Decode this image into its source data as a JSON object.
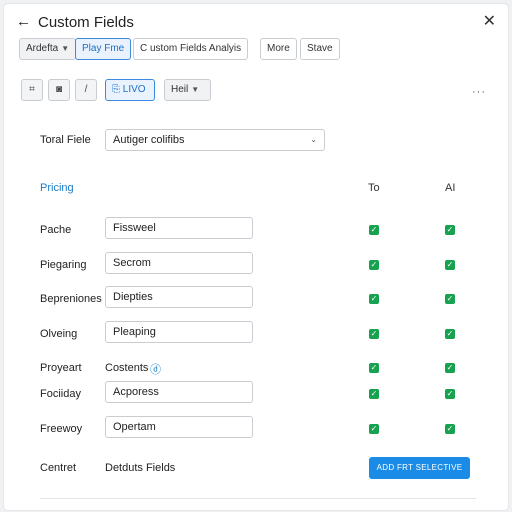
{
  "header": {
    "back_icon": "arrow-left-icon",
    "title": "Custom Fields",
    "close_icon": "close-icon"
  },
  "toolbar1": {
    "dropdown_label": "Ardefta",
    "play_label": "Play Fme",
    "analysis_label": "C ustom Fields Analyis",
    "more_label": "More",
    "save_label": "Stave"
  },
  "toolbar2": {
    "icons": [
      "hash-icon",
      "shield-icon",
      "slash-icon"
    ],
    "icon_glyphs": [
      "⌗",
      "◙",
      "/"
    ],
    "live_label": "LIVO",
    "hell_label": "Heil",
    "more_glyph": "···"
  },
  "total_field": {
    "label": "Toral Fiele",
    "value": "Autiger colifibs"
  },
  "section": {
    "title": "Pricing",
    "col_to": "To",
    "col_ai": "AI"
  },
  "rows": [
    {
      "label": "Pache",
      "value": "Fissweel",
      "has_input": true,
      "to": true,
      "ai": true
    },
    {
      "label": "Piegaring",
      "value": "Secrom",
      "has_input": true,
      "to": true,
      "ai": true
    },
    {
      "label": "Bepreniones",
      "value": "Diepties",
      "has_input": true,
      "to": true,
      "ai": true
    },
    {
      "label": "Olveing",
      "value": "Pleaping",
      "has_input": true,
      "to": true,
      "ai": true
    },
    {
      "label": "Proyeart",
      "value": "Costents",
      "has_input": false,
      "extra": "ⓓ",
      "to": true,
      "ai": true
    },
    {
      "label": "Fociiday",
      "value": "Acporess",
      "has_input": true,
      "to": true,
      "ai": true
    },
    {
      "label": "Freewoy",
      "value": "Opertam",
      "has_input": true,
      "to": true,
      "ai": true
    }
  ],
  "footer": {
    "label": "Centret",
    "value": "Detduts Fields",
    "button_label": "ADD FRT SELECTIVE"
  },
  "colors": {
    "accent": "#1a8be6",
    "check": "#17a24f",
    "section": "#1a7dc9"
  }
}
